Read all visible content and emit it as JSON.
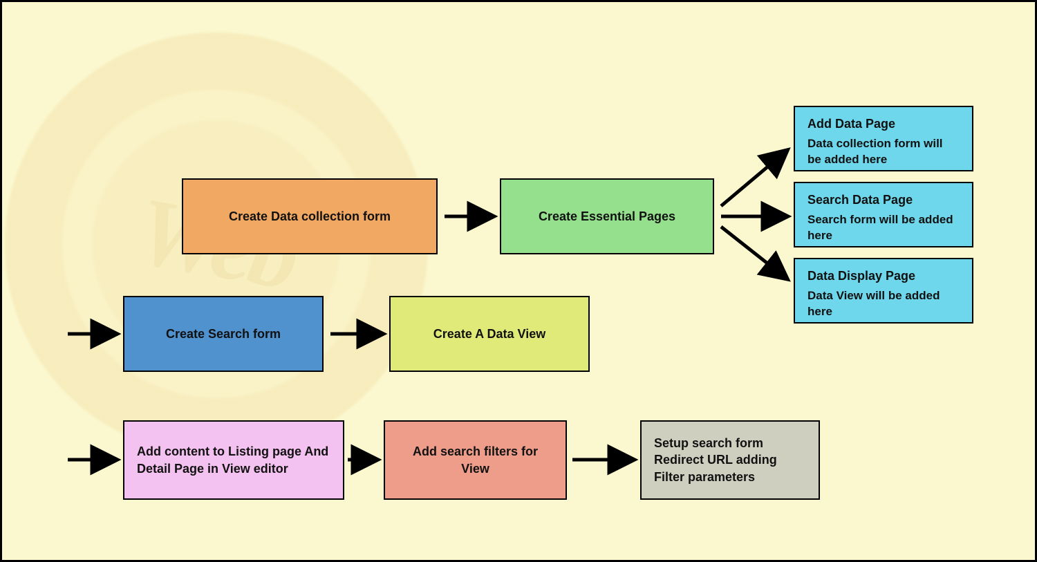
{
  "watermark": "Web",
  "boxes": {
    "b1": "Create Data collection form",
    "b2": "Create Essential Pages",
    "b3": "Create Search form",
    "b4": "Create A Data View",
    "b5": "Add content to Listing page And Detail Page in View editor",
    "b6": "Add search filters for View",
    "b7": "Setup search form Redirect URL adding Filter parameters",
    "p1": {
      "title": "Add Data Page",
      "desc": "Data collection form will be added here"
    },
    "p2": {
      "title": "Search Data Page",
      "desc": "Search form will be added here"
    },
    "p3": {
      "title": "Data Display Page",
      "desc": "Data View will be added here"
    }
  }
}
